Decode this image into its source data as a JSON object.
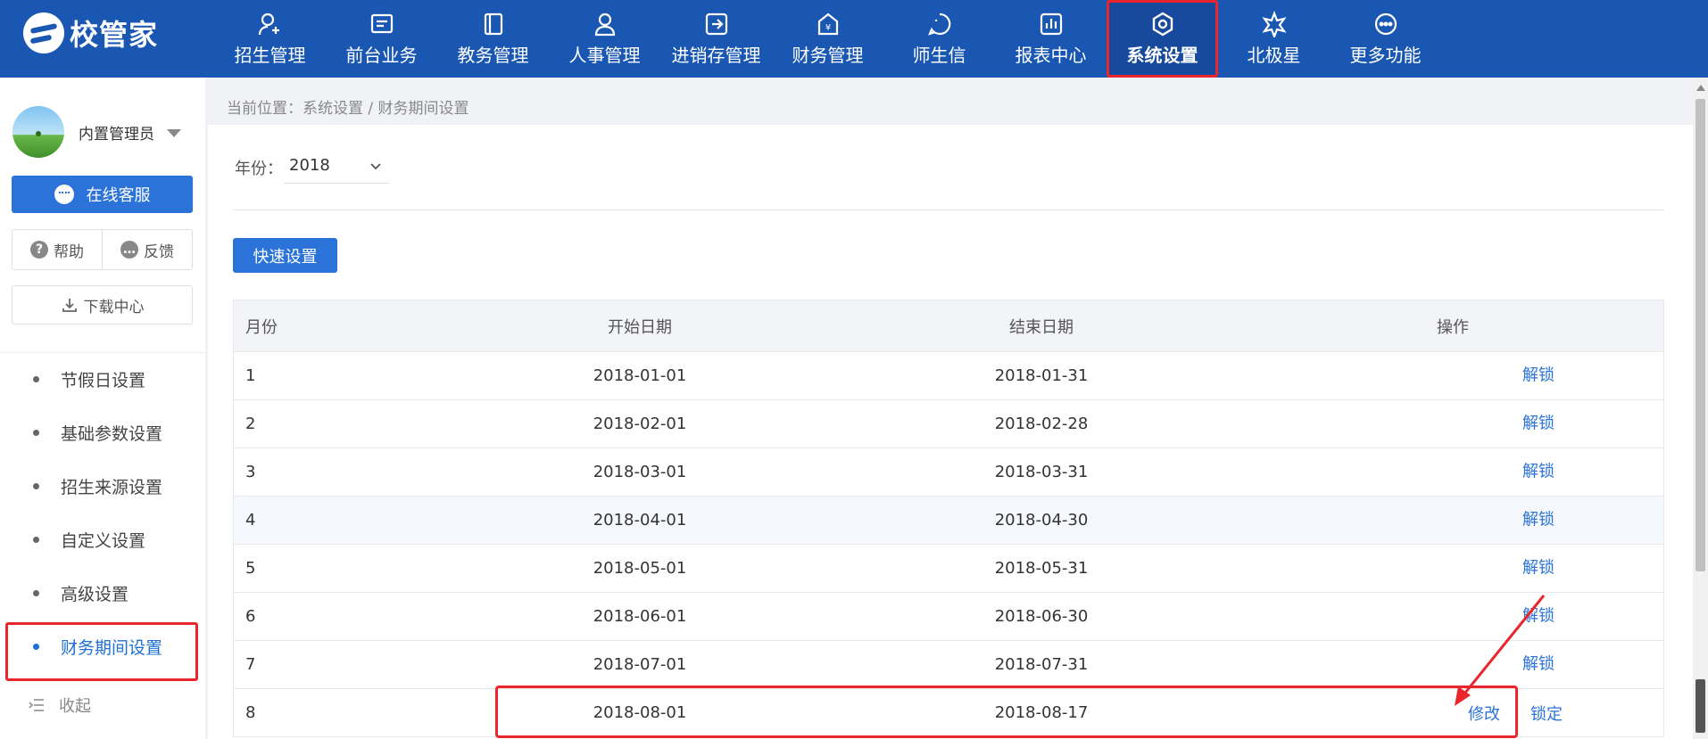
{
  "app": {
    "logo_text": "校管家"
  },
  "nav": [
    {
      "label": "招生管理",
      "icon": "user-add-icon"
    },
    {
      "label": "前台业务",
      "icon": "monitor-icon"
    },
    {
      "label": "教务管理",
      "icon": "book-icon"
    },
    {
      "label": "人事管理",
      "icon": "person-icon"
    },
    {
      "label": "进销存管理",
      "icon": "inventory-icon"
    },
    {
      "label": "财务管理",
      "icon": "finance-icon"
    },
    {
      "label": "师生信",
      "icon": "message-icon"
    },
    {
      "label": "报表中心",
      "icon": "report-icon"
    },
    {
      "label": "系统设置",
      "icon": "settings-icon",
      "active": true
    },
    {
      "label": "北极星",
      "icon": "star-icon"
    },
    {
      "label": "更多功能",
      "icon": "more-icon"
    }
  ],
  "sidebar": {
    "user_name": "内置管理员",
    "service_button": "在线客服",
    "help": "帮助",
    "feedback": "反馈",
    "download": "下载中心",
    "menu": [
      {
        "label": "节假日设置"
      },
      {
        "label": "基础参数设置"
      },
      {
        "label": "招生来源设置"
      },
      {
        "label": "自定义设置"
      },
      {
        "label": "高级设置"
      },
      {
        "label": "财务期间设置",
        "active": true
      }
    ],
    "collapse": "收起"
  },
  "breadcrumb": "当前位置：系统设置 / 财务期间设置",
  "filter": {
    "year_label": "年份：",
    "year_value": "2018"
  },
  "quick_setup_button": "快速设置",
  "table": {
    "headers": [
      "月份",
      "开始日期",
      "结束日期",
      "操作"
    ],
    "rows": [
      {
        "month": "1",
        "start": "2018-01-01",
        "end": "2018-01-31",
        "actions": [
          "解锁"
        ]
      },
      {
        "month": "2",
        "start": "2018-02-01",
        "end": "2018-02-28",
        "actions": [
          "解锁"
        ]
      },
      {
        "month": "3",
        "start": "2018-03-01",
        "end": "2018-03-31",
        "actions": [
          "解锁"
        ]
      },
      {
        "month": "4",
        "start": "2018-04-01",
        "end": "2018-04-30",
        "actions": [
          "解锁"
        ]
      },
      {
        "month": "5",
        "start": "2018-05-01",
        "end": "2018-05-31",
        "actions": [
          "解锁"
        ]
      },
      {
        "month": "6",
        "start": "2018-06-01",
        "end": "2018-06-30",
        "actions": [
          "解锁"
        ]
      },
      {
        "month": "7",
        "start": "2018-07-01",
        "end": "2018-07-31",
        "actions": [
          "解锁"
        ]
      },
      {
        "month": "8",
        "start": "2018-08-01",
        "end": "2018-08-17",
        "actions": [
          "修改",
          "锁定"
        ]
      }
    ]
  },
  "colors": {
    "topbar": "#1a57b2",
    "primary": "#2b73d8",
    "annotation": "#e8262b"
  }
}
